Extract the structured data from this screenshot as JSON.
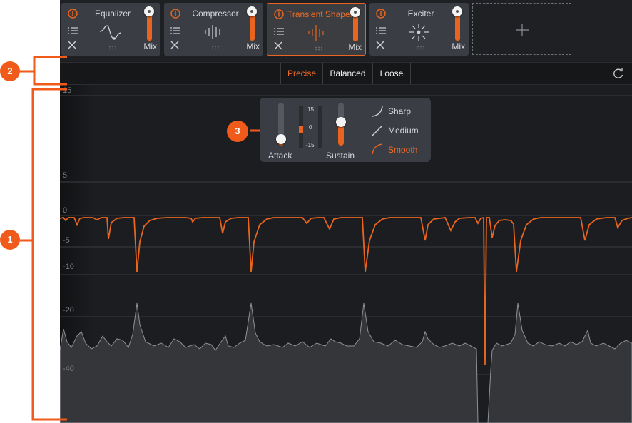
{
  "modules": [
    {
      "name": "Equalizer",
      "mix_label": "Mix",
      "active": false,
      "graphic": "eq-curve-icon"
    },
    {
      "name": "Compressor",
      "mix_label": "Mix",
      "active": false,
      "graphic": "compressor-bars-icon"
    },
    {
      "name": "Transient Shaper",
      "mix_label": "Mix",
      "active": true,
      "graphic": "transient-bars-icon"
    },
    {
      "name": "Exciter",
      "mix_label": "Mix",
      "active": false,
      "graphic": "exciter-burst-icon"
    }
  ],
  "add_module": {
    "icon": "plus-icon"
  },
  "modes": {
    "items": [
      "Precise",
      "Balanced",
      "Loose"
    ],
    "selected": "Precise"
  },
  "graph": {
    "scale_labels": [
      "15",
      "5",
      "0",
      "-5",
      "-10",
      "-20",
      "-40"
    ]
  },
  "popup": {
    "attack_label": "Attack",
    "sustain_label": "Sustain",
    "meter_scale": [
      "15",
      "0",
      "-15"
    ],
    "attack_level": 0.15,
    "sustain_level": 0.55,
    "curve_options": [
      "Sharp",
      "Medium",
      "Smooth"
    ],
    "curve_selected": "Smooth"
  },
  "callouts": [
    "1",
    "2",
    "3"
  ],
  "colors": {
    "accent": "#e8641f",
    "panel": "#1b1d20",
    "module": "#3a3e44",
    "callout": "#f05a1a"
  }
}
